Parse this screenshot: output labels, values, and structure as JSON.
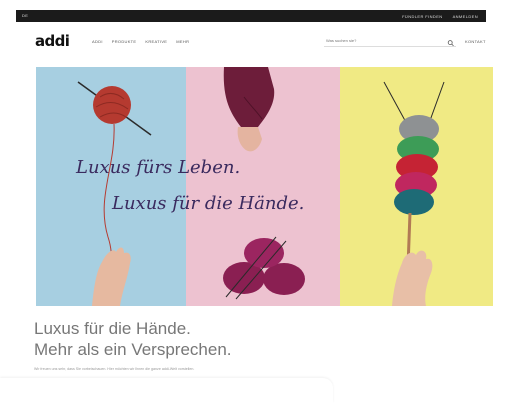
{
  "topbar": {
    "lang": "DE",
    "links": [
      "FÜNDLER FINDEN",
      "ANMELDEN"
    ]
  },
  "header": {
    "logo": "addi",
    "nav": [
      "ADDI",
      "PRODUKTE",
      "KREATIVE",
      "MEHR"
    ],
    "search_placeholder": "Was suchen sie?",
    "account": "KONTAKT"
  },
  "hero": {
    "script_line1": "Luxus fürs Leben.",
    "script_line2": "Luxus für die Hände.",
    "panel_colors": [
      "#a7cfe1",
      "#edc2d0",
      "#f0ea84"
    ]
  },
  "content": {
    "headline_line1": "Luxus für die Hände.",
    "headline_line2": "Mehr als ein Versprechen.",
    "paragraph": "Wir freuen uns sehr, dass Sie vorbeischauen. Hier möchten wir Ihnen die ganze addi-Welt vorstellen."
  },
  "icons": {
    "search": "search-icon"
  }
}
